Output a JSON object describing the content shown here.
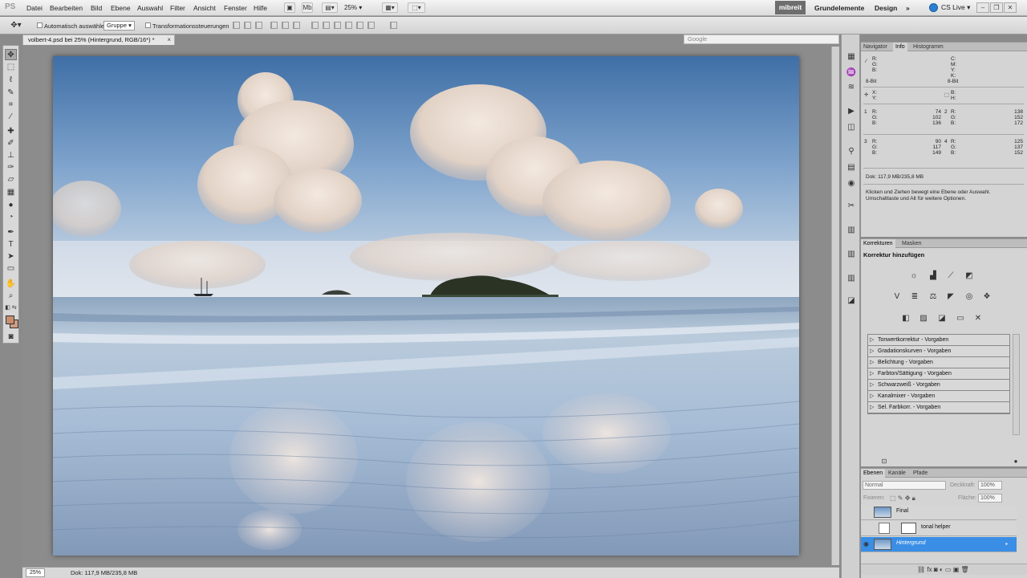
{
  "app": {
    "logo": "PS",
    "menu": [
      "Datei",
      "Bearbeiten",
      "Bild",
      "Ebene",
      "Auswahl",
      "Filter",
      "Ansicht",
      "Fenster",
      "Hilfe"
    ],
    "zoom": "25%",
    "workspaces": {
      "active": "mibreit",
      "others": [
        "Grundelemente",
        "Design"
      ],
      "more": "»"
    },
    "cslive": "CS Live"
  },
  "options": {
    "auto_select_label": "Automatisch auswählen:",
    "auto_select_value": "Gruppe",
    "transform_label": "Transformationssteuerungen"
  },
  "document": {
    "tab_title": "volbert-4.psd bei 25% (Hintergrund, RGB/16*) *",
    "close": "×",
    "google_placeholder": "Google",
    "status_zoom": "25%",
    "status_doc": "Dok: 117,9 MB/235,8 MB"
  },
  "info_panel": {
    "tabs": [
      "Navigator",
      "Info",
      "Histogramm"
    ],
    "rgb1": {
      "r": "R:",
      "g": "G:",
      "b": "B:"
    },
    "cmyk": {
      "c": "C:",
      "m": "M:",
      "y": "Y:",
      "k": "K:"
    },
    "bitdepth": "8-Bit",
    "xy": {
      "x": "X:",
      "y": "Y:"
    },
    "wh": {
      "w": "B:",
      "h": "H:"
    },
    "samplers": [
      {
        "n": "1",
        "r": "74",
        "g": "102",
        "b": "136"
      },
      {
        "n": "2",
        "r": "138",
        "g": "152",
        "b": "172"
      },
      {
        "n": "3",
        "r": "90",
        "g": "117",
        "b": "149"
      },
      {
        "n": "4",
        "r": "125",
        "g": "137",
        "b": "152"
      }
    ],
    "doc": "Dok: 117,9 MB/235,8 MB",
    "hint": "Klicken und Ziehen bewegt eine Ebene oder Auswahl. Umschalttaste und Alt für weitere Optionen."
  },
  "adjust_panel": {
    "tabs": [
      "Korrekturen",
      "Masken"
    ],
    "title": "Korrektur hinzufügen",
    "presets": [
      "Tonwertkorrektur - Vorgaben",
      "Gradationskurven - Vorgaben",
      "Belichtung - Vorgaben",
      "Farbton/Sättigung - Vorgaben",
      "Schwarzweiß - Vorgaben",
      "Kanalmixer - Vorgaben",
      "Sel. Farbkorr. - Vorgaben"
    ]
  },
  "layers_panel": {
    "tabs": [
      "Ebenen",
      "Kanäle",
      "Pfade"
    ],
    "blend_mode": "Normal",
    "opacity_label": "Deckkraft:",
    "opacity": "100%",
    "lock_label": "Fixieren:",
    "fill_label": "Fläche:",
    "fill": "100%",
    "layers": [
      {
        "name": "Final"
      },
      {
        "name": "tonal helper"
      },
      {
        "name": "Hintergrund"
      }
    ]
  }
}
